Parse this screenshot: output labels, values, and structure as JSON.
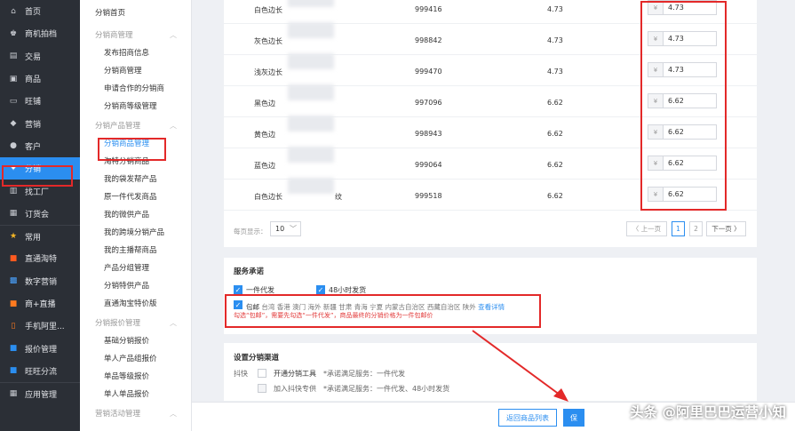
{
  "left_nav": [
    {
      "label": "首页",
      "icon": "home-icon"
    },
    {
      "label": "商机拍档",
      "icon": "handshake-icon"
    },
    {
      "label": "交易",
      "icon": "cart-icon"
    },
    {
      "label": "商品",
      "icon": "box-icon"
    },
    {
      "label": "旺铺",
      "icon": "store-icon"
    },
    {
      "label": "营销",
      "icon": "tag-icon"
    },
    {
      "label": "客户",
      "icon": "user-icon"
    },
    {
      "label": "分销",
      "icon": "share-icon",
      "active": true
    },
    {
      "label": "找工厂",
      "icon": "factory-icon"
    },
    {
      "label": "订货会",
      "icon": "calendar-icon"
    },
    {
      "label": "常用",
      "icon": "star-icon",
      "sep": true
    },
    {
      "label": "直通淘特",
      "icon": "taote-icon"
    },
    {
      "label": "数字营销",
      "icon": "digital-icon"
    },
    {
      "label": "商+直播",
      "icon": "live-icon"
    },
    {
      "label": "手机阿里...",
      "icon": "phone-icon"
    },
    {
      "label": "报价管理",
      "icon": "quote-icon"
    },
    {
      "label": "旺旺分流",
      "icon": "wangwang-icon"
    },
    {
      "label": "应用管理",
      "icon": "apps-icon",
      "sep": true
    }
  ],
  "sub_nav": [
    {
      "type": "home",
      "label": "分销首页"
    },
    {
      "type": "group",
      "label": "分销商管理",
      "caret": "︿"
    },
    {
      "type": "item",
      "label": "发布招商信息"
    },
    {
      "type": "item",
      "label": "分销商管理"
    },
    {
      "type": "item",
      "label": "申请合作的分销商"
    },
    {
      "type": "item",
      "label": "分销商等级管理"
    },
    {
      "type": "group",
      "label": "分销产品管理",
      "caret": "︿"
    },
    {
      "type": "item",
      "label": "分销商品管理",
      "active": true
    },
    {
      "type": "item",
      "label": "淘特分销商品"
    },
    {
      "type": "item",
      "label": "我的袋发帮产品"
    },
    {
      "type": "item",
      "label": "原一件代发商品"
    },
    {
      "type": "item",
      "label": "我的微供产品"
    },
    {
      "type": "item",
      "label": "我的跨境分销产品"
    },
    {
      "type": "item",
      "label": "我的主播帮商品"
    },
    {
      "type": "item",
      "label": "产品分组管理"
    },
    {
      "type": "item",
      "label": "分销特供产品"
    },
    {
      "type": "item",
      "label": "直通淘宝特价版"
    },
    {
      "type": "group",
      "label": "分销报价管理",
      "caret": "︿"
    },
    {
      "type": "item",
      "label": "基础分销报价"
    },
    {
      "type": "item",
      "label": "单人产品组报价"
    },
    {
      "type": "item",
      "label": "单品等级报价"
    },
    {
      "type": "item",
      "label": "单人单品报价"
    },
    {
      "type": "group",
      "label": "营销活动管理",
      "caret": "︿"
    }
  ],
  "table": {
    "currency_symbol": "¥",
    "rows": [
      {
        "name": "白色边长",
        "code": "999416",
        "price": "4.73",
        "dist_price": "4.73"
      },
      {
        "name": "灰色边长",
        "code": "998842",
        "price": "4.73",
        "dist_price": "4.73"
      },
      {
        "name": "浅灰边长",
        "code": "999470",
        "price": "4.73",
        "dist_price": "4.73"
      },
      {
        "name": "黑色边",
        "code": "997096",
        "price": "6.62",
        "dist_price": "6.62"
      },
      {
        "name": "黄色边",
        "code": "998943",
        "price": "6.62",
        "dist_price": "6.62"
      },
      {
        "name": "蓝色边",
        "code": "999064",
        "price": "6.62",
        "dist_price": "6.62"
      },
      {
        "name": "白色边长",
        "name_suffix": "纹",
        "code": "999518",
        "price": "6.62",
        "dist_price": "6.62"
      }
    ]
  },
  "pager": {
    "per_page_label": "每页显示：",
    "per_page_value": "10",
    "prev_label": "〈 上一页",
    "pages": [
      "1",
      "2"
    ],
    "current_page": "1",
    "next_label": "下一页 〉"
  },
  "service": {
    "title": "服务承诺",
    "opt1": "一件代发",
    "opt2": "48小时发货",
    "free_label": "包邮",
    "areas": "台湾 香港 澳门 海外 新疆 甘肃 青海 宁夏 内蒙古自治区 西藏自治区 陕外",
    "details_link": "查看详情",
    "note": "勾选“包邮”，需要先勾选“一件代发”，商品最终的分销价格为一件包邮价"
  },
  "channel": {
    "title": "设置分销渠道",
    "platform": "抖快",
    "item1_label": "开通分销工具",
    "item1_req": "*承诺满足服务：一件代发",
    "item2_label": "加入抖快专供",
    "item2_req": "*承诺满足服务：一件代发、48小时发货"
  },
  "bottom": {
    "back_label": "返回商品列表",
    "save_label": "保"
  },
  "watermark": "头条 @阿里巴巴运营小知",
  "colors": {
    "accent": "#2b8ef0",
    "highlight": "#e32929",
    "sidebar": "#2b2f36"
  }
}
